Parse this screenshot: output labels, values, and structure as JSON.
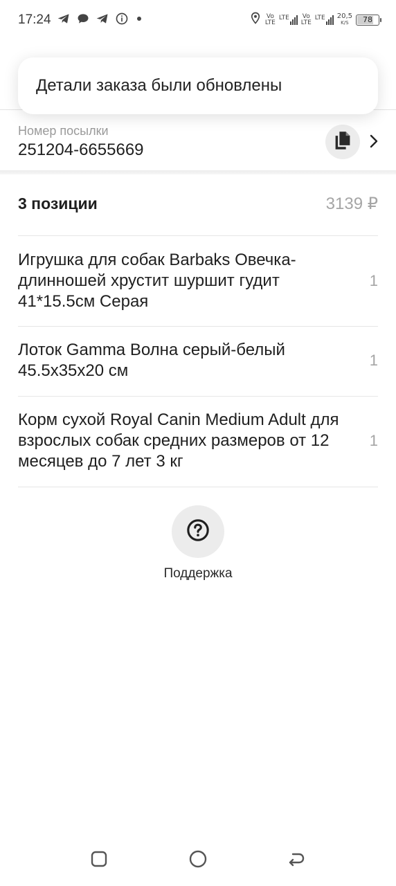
{
  "status_bar": {
    "time": "17:24",
    "left_icons": [
      "telegram-icon",
      "chat-bubble-icon",
      "telegram-icon",
      "info-icon",
      "dot-icon"
    ],
    "right_icons": [
      "location-icon",
      "volte-icon",
      "lte-signal-icon",
      "volte-icon",
      "lte-signal-icon"
    ],
    "volte_top": "Vo",
    "volte_bottom": "LTE",
    "lte_label": "LTE",
    "net_speed_value": "20,5",
    "net_speed_unit": "K/S",
    "battery_level": "78",
    "battery_fraction": 0.78
  },
  "toast": {
    "text": "Детали заказа были обновлены"
  },
  "parcel": {
    "label": "Номер посылки",
    "number": "251204-6655669"
  },
  "positions": {
    "title": "3 позиции",
    "total": "3139 ₽",
    "items": [
      {
        "name": "Игрушка для собак Barbaks Овечка-длинношей хрустит шуршит гудит 41*15.5см Серая",
        "qty": "1"
      },
      {
        "name": "Лоток Gamma Волна серый-белый 45.5x35x20 см",
        "qty": "1"
      },
      {
        "name": "Корм сухой Royal Canin Medium Adult для взрослых собак средних размеров от 12 месяцев до 7 лет 3 кг",
        "qty": "1"
      }
    ]
  },
  "support": {
    "label": "Поддержка"
  },
  "colors": {
    "text": "#1f1f1f",
    "muted": "#a5a5a5",
    "circle_bg": "#ececec",
    "divider": "#e6e6e6"
  }
}
